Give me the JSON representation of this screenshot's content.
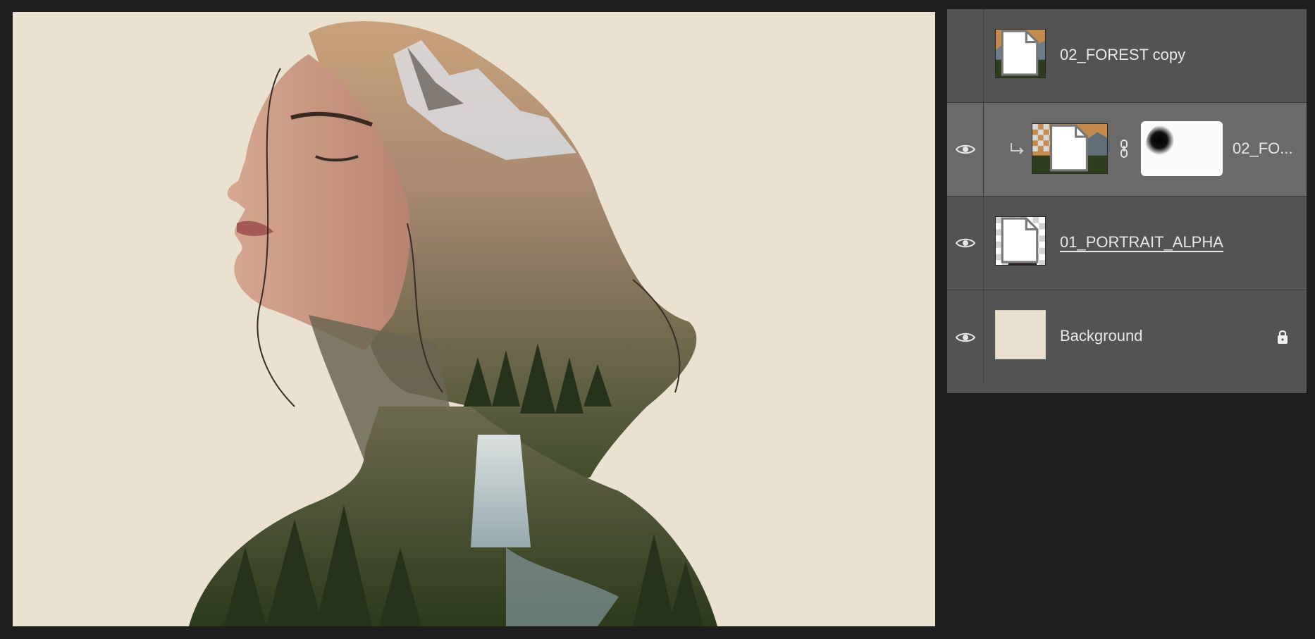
{
  "canvas": {
    "background_color": "#ebe1d1",
    "image_description_name": "double-exposure-artwork"
  },
  "layers_panel": {
    "layers": [
      {
        "name": "02_FOREST copy",
        "visible": false,
        "selected": false,
        "underlined": false,
        "icon": "smart-object-badge"
      },
      {
        "name": "02_FO...",
        "visible": true,
        "selected": true,
        "clipped": true,
        "has_mask": true,
        "icon": "link-icon"
      },
      {
        "name": "01_PORTRAIT_ALPHA",
        "visible": true,
        "selected": false,
        "underlined": true,
        "icon": "smart-object-badge"
      },
      {
        "name": "Background",
        "visible": true,
        "selected": false,
        "locked": true,
        "icon": "lock-icon"
      }
    ]
  },
  "colors": {
    "panel_bg": "#535353",
    "selected_row": "#6a6a6a",
    "app_bg": "#1e1e1e",
    "text": "#e8e8e8"
  }
}
